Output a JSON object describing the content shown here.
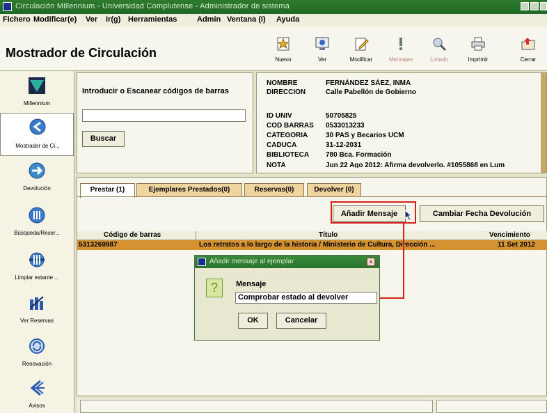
{
  "window": {
    "title": "Circulación Millennium - Universidad Complutense - Administrador de sistema"
  },
  "menu": [
    "Fichero",
    "Modificar(e)",
    "Ver",
    "Ir(g)",
    "Herramientas",
    "Admin",
    "Ventana (I)",
    "Ayuda"
  ],
  "header": {
    "title": "Mostrador de Circulación"
  },
  "toolbar": [
    {
      "label": "Nuevo",
      "icon": "new-icon",
      "enabled": true
    },
    {
      "label": "Ver",
      "icon": "view-icon",
      "enabled": true
    },
    {
      "label": "Modificar",
      "icon": "edit-icon",
      "enabled": true
    },
    {
      "label": "Mensajes",
      "icon": "messages-icon",
      "enabled": false
    },
    {
      "label": "Listado",
      "icon": "list-search-icon",
      "enabled": false
    },
    {
      "label": "Imprimir",
      "icon": "printer-icon",
      "enabled": true
    },
    {
      "label": "Cerrar",
      "icon": "close-folder-icon",
      "enabled": true
    }
  ],
  "sidebar": [
    {
      "label": "Millennium",
      "icon": "millennium-logo-icon",
      "active": false
    },
    {
      "label": "Mostrador de Ci...",
      "icon": "circulation-desk-icon",
      "active": true
    },
    {
      "label": "Devolución",
      "icon": "return-icon",
      "active": false
    },
    {
      "label": "Búsqueda/Reser...",
      "icon": "search-reserve-icon",
      "active": false
    },
    {
      "label": "Limpiar estante ...",
      "icon": "clear-shelf-icon",
      "active": false
    },
    {
      "label": "Ver Reservas",
      "icon": "view-reserves-icon",
      "active": false
    },
    {
      "label": "Renovación",
      "icon": "renew-icon",
      "active": false
    },
    {
      "label": "Avisos",
      "icon": "notices-icon",
      "active": false
    }
  ],
  "scan": {
    "label": "Introducir o Escanear códigos de barras",
    "value": "",
    "button": "Buscar"
  },
  "patron": [
    {
      "key": "NOMBRE",
      "value": "FERNÁNDEZ SÁEZ, INMA"
    },
    {
      "key": "DIRECCION",
      "value": "Calle  Pabellón de Gobierno"
    },
    {
      "key": "",
      "value": ""
    },
    {
      "key": "ID UNIV",
      "value": "50705825"
    },
    {
      "key": "COD BARRAS",
      "value": "0533013233"
    },
    {
      "key": "CATEGORIA",
      "value": "30 PAS y Becarios UCM"
    },
    {
      "key": "CADUCA",
      "value": "31-12-2031"
    },
    {
      "key": "BIBLIOTECA",
      "value": "780  Bca. Formación"
    },
    {
      "key": "NOTA",
      "value": "Jun 22 Ago 2012: Afirma devolverlo. #1055868 en Lum"
    }
  ],
  "tabs": [
    "Prestar (1)",
    "Ejemplares Prestados(0)",
    "Reservas(0)",
    "Devolver (0)"
  ],
  "actions": {
    "add_message": "Añadir Mensaje",
    "change_due": "Cambiar Fecha Devolución"
  },
  "grid": {
    "headers": [
      "Código de barras",
      "Título",
      "Vencimiento"
    ],
    "rows": [
      {
        "barcode": "5313269987",
        "title": "Los retratos a lo largo de la historia / Ministerio de Cultura, Dirección ...",
        "due": "11 Set 2012"
      }
    ]
  },
  "dialog": {
    "title": "Añadir mensaje al ejemplar",
    "label": "Mensaje",
    "value": "Comprobar estado al devolver",
    "ok": "OK",
    "cancel": "Cancelar"
  },
  "colors": {
    "title_bar": "#2f7a2f",
    "highlight": "#d8201a",
    "selected_row": "#d49230",
    "tab": "#f0d4a0"
  }
}
